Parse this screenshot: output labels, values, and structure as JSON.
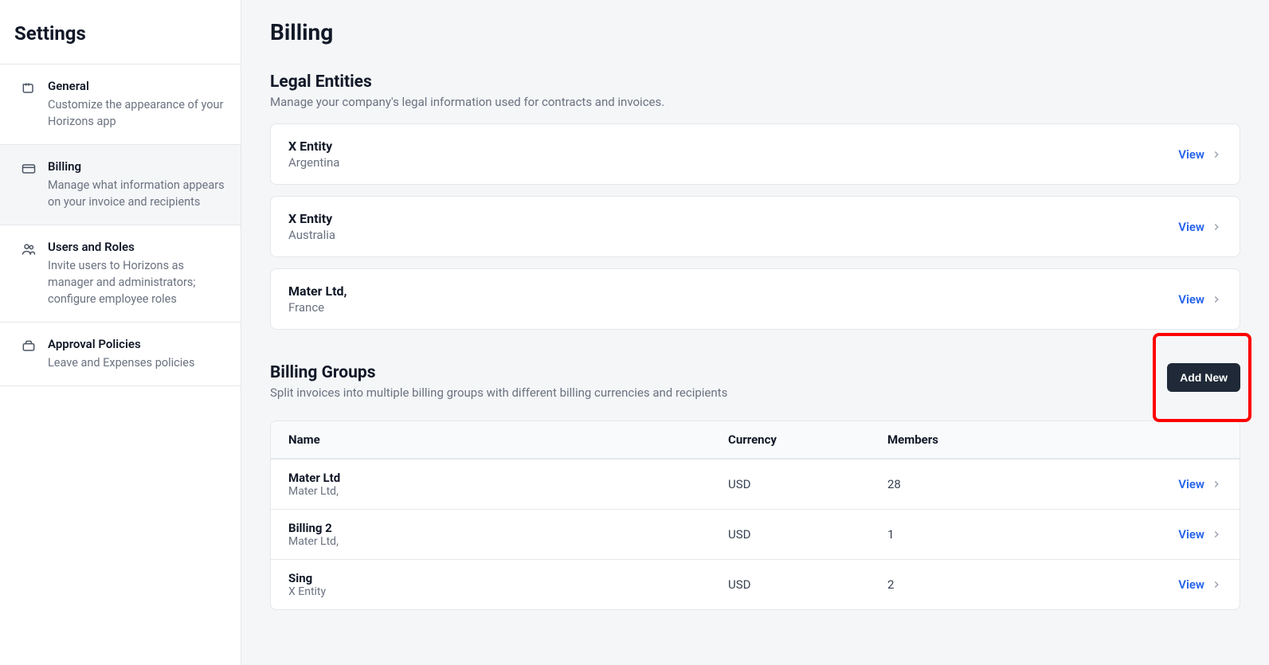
{
  "sidebar": {
    "title": "Settings",
    "items": [
      {
        "title": "General",
        "desc": "Customize the appearance of your Horizons app"
      },
      {
        "title": "Billing",
        "desc": "Manage what information appears on your invoice and recipients"
      },
      {
        "title": "Users and Roles",
        "desc": "Invite users to Horizons as manager and administrators; configure employee roles"
      },
      {
        "title": "Approval Policies",
        "desc": "Leave and Expenses policies"
      }
    ]
  },
  "main": {
    "title": "Billing",
    "legal": {
      "title": "Legal Entities",
      "desc": "Manage your company's legal information used for contracts and invoices.",
      "entities": [
        {
          "name": "X Entity",
          "country": "Argentina"
        },
        {
          "name": "X Entity",
          "country": "Australia"
        },
        {
          "name": "Mater Ltd,",
          "country": "France"
        }
      ]
    },
    "groups": {
      "title": "Billing Groups",
      "desc": "Split invoices into multiple billing groups with different billing currencies and recipients",
      "add_label": "Add New",
      "columns": {
        "name": "Name",
        "currency": "Currency",
        "members": "Members"
      },
      "rows": [
        {
          "name": "Mater Ltd",
          "sub": "Mater Ltd,",
          "currency": "USD",
          "members": "28"
        },
        {
          "name": "Billing 2",
          "sub": "Mater Ltd,",
          "currency": "USD",
          "members": "1"
        },
        {
          "name": "Sing",
          "sub": "X Entity",
          "currency": "USD",
          "members": "2"
        }
      ]
    },
    "view_label": "View"
  }
}
